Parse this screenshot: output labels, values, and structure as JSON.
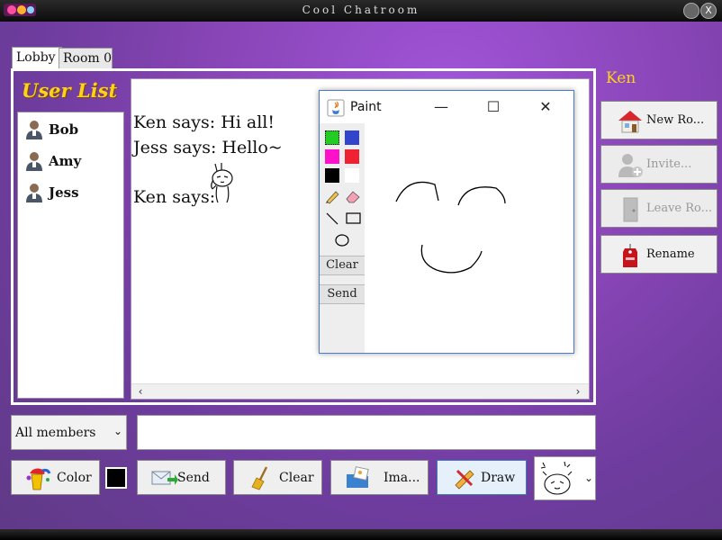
{
  "window": {
    "title": "Cool Chatroom",
    "close_glyph": "X"
  },
  "tabs": [
    {
      "label": "Lobby",
      "active": true
    },
    {
      "label": "Room 0",
      "active": false
    }
  ],
  "user_list": {
    "title": "User List",
    "users": [
      {
        "name": "Bob",
        "icon": "user-avatar-icon"
      },
      {
        "name": "Amy",
        "icon": "user-avatar-icon"
      },
      {
        "name": "Jess",
        "icon": "user-avatar-icon"
      }
    ]
  },
  "chat": {
    "messages": [
      {
        "text": "Ken says: Hi all!"
      },
      {
        "text": "Jess says: Hello~"
      },
      {
        "text": "Ken says:",
        "sticker": "waving-bunny-sticker"
      }
    ],
    "scroll_left": "‹",
    "scroll_right": "›"
  },
  "paint": {
    "title": "Paint",
    "min_glyph": "—",
    "max_glyph": "☐",
    "close_glyph": "✕",
    "palette": [
      "#22cc22",
      "#3344cc",
      "#ff11cc",
      "#ee2233",
      "#000000",
      "#ffffff"
    ],
    "clear_label": "Clear",
    "send_label": "Send"
  },
  "sidebar": {
    "username": "Ken",
    "buttons": [
      {
        "label": "New Ro...",
        "icon": "house-icon",
        "enabled": true
      },
      {
        "label": "Invite...",
        "icon": "add-user-icon",
        "enabled": false
      },
      {
        "label": "Leave Ro...",
        "icon": "door-icon",
        "enabled": false
      },
      {
        "label": "Rename",
        "icon": "tag-icon",
        "enabled": true
      }
    ]
  },
  "compose": {
    "recipient": "All members",
    "recipient_chev": "⌄",
    "message_value": ""
  },
  "toolbar": {
    "color_label": "Color",
    "current_color": "#000000",
    "send_label": "Send",
    "clear_label": "Clear",
    "image_label": "Ima...",
    "draw_label": "Draw",
    "sticker_chev": "⌄"
  }
}
